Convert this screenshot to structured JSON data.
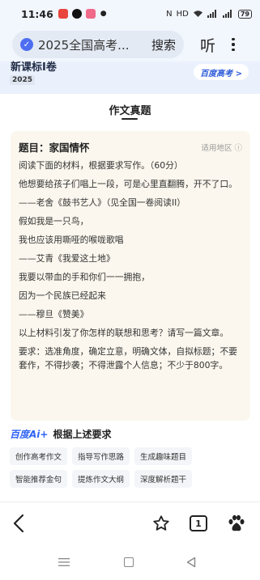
{
  "status_bar": {
    "time": "11:46",
    "battery": "79"
  },
  "search_bar": {
    "query": "2025全国高考...",
    "search_label": "搜索",
    "listen_label": "听"
  },
  "banner": {
    "title": "新课标I卷",
    "year": "2025",
    "brand_label": "百度高考 >"
  },
  "section": {
    "title": "作文真题"
  },
  "essay": {
    "title": "题目：家国情怀",
    "region_label": "适用地区 ⓘ",
    "paragraphs": [
      "阅读下面的材料，根据要求写作。（60分）",
      "他想要给孩子们唱上一段，可是心里直翻腾，开不了口。",
      "——老舍《鼓书艺人》（见全国一卷阅读II）",
      "假如我是一只鸟，",
      "我也应该用嘶哑的喉咙歌唱",
      "——艾青《我爱这土地》",
      "我要以带血的手和你们一一拥抱，",
      "因为一个民族已经起来",
      "——穆旦《赞美》",
      "以上材料引发了你怎样的联想和思考？请写一篇文章。",
      "要求：选准角度，确定立意，明确文体，自拟标题；不要套作，不得抄袭；不得泄露个人信息；不少于800字。"
    ]
  },
  "ai_section": {
    "logo": "百度Ai+",
    "title": "根据上述要求",
    "chips": [
      "创作高考作文",
      "指导写作思路",
      "生成趣味题目",
      "智能推荐金句",
      "提炼作文大纲",
      "深度解析题干"
    ]
  },
  "bottom_nav": {
    "tab_count": "1"
  }
}
